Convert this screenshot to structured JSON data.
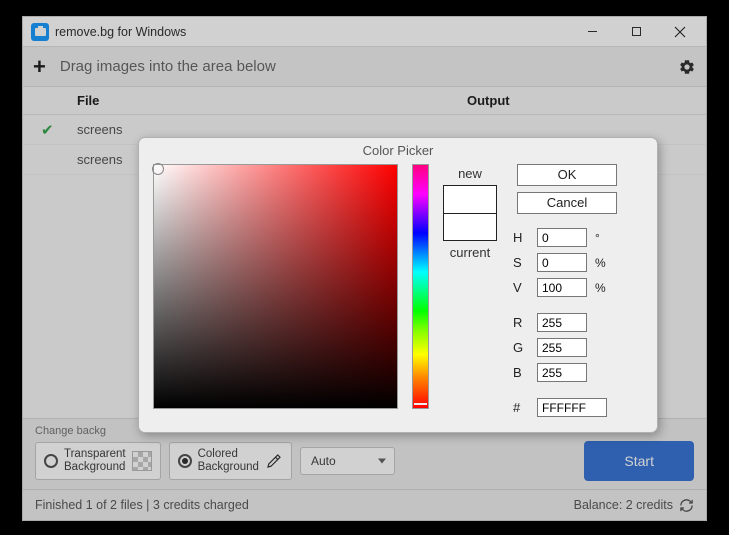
{
  "window": {
    "title": "remove.bg for Windows"
  },
  "toolbar": {
    "drag_hint": "Drag images into the area below"
  },
  "columns": {
    "file": "File",
    "output": "Output"
  },
  "rows": [
    {
      "done": true,
      "name": "screens"
    },
    {
      "done": false,
      "name": "screens"
    }
  ],
  "bottom": {
    "change_label": "Change backg",
    "transparent": "Transparent\nBackground",
    "colored": "Colored\nBackground",
    "size_select": "Auto",
    "start": "Start"
  },
  "status": {
    "left": "Finished 1 of 2 files | 3 credits charged",
    "right": "Balance: 2 credits"
  },
  "picker": {
    "title": "Color Picker",
    "new": "new",
    "current": "current",
    "ok": "OK",
    "cancel": "Cancel",
    "H": {
      "label": "H",
      "value": "0",
      "unit": "°"
    },
    "S": {
      "label": "S",
      "value": "0",
      "unit": "%"
    },
    "V": {
      "label": "V",
      "value": "100",
      "unit": "%"
    },
    "R": {
      "label": "R",
      "value": "255"
    },
    "G": {
      "label": "G",
      "value": "255"
    },
    "B": {
      "label": "B",
      "value": "255"
    },
    "hex": {
      "label": "#",
      "value": "FFFFFF"
    }
  }
}
